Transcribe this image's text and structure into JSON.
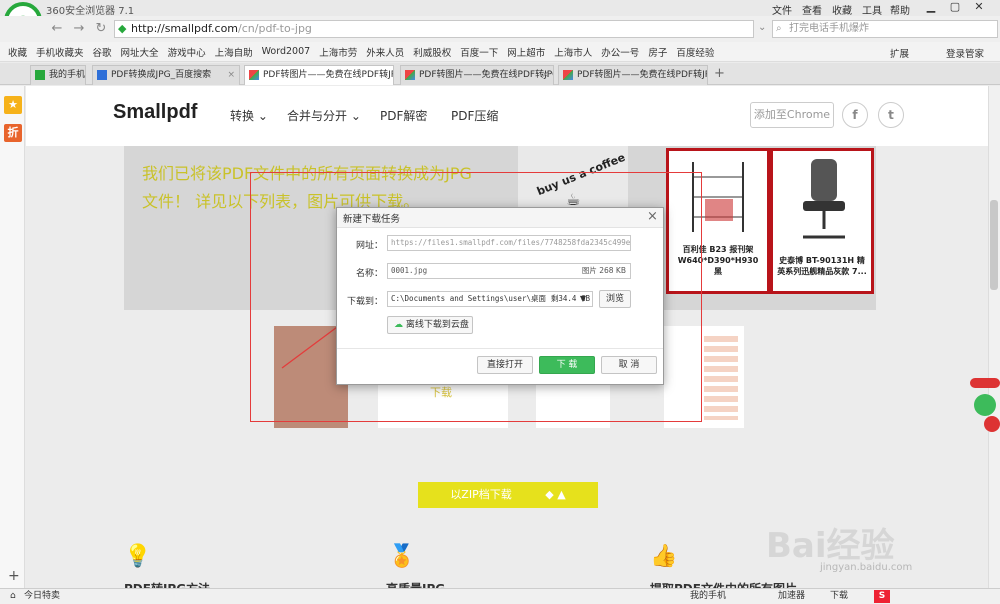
{
  "browser": {
    "app_title": "360安全浏览器 7.1",
    "menu": [
      "文件",
      "查看",
      "收藏",
      "工具",
      "帮助"
    ],
    "url_host": "http://smallpdf.com",
    "url_path": "/cn/pdf-to-jpg",
    "search_placeholder": "打完电话手机爆炸",
    "bookmarks": [
      "收藏",
      "手机收藏夹",
      "谷歌",
      "网址大全",
      "游戏中心",
      "上海自助",
      "Word2007",
      "上海市劳",
      "外来人员",
      "利威股权",
      "百度一下",
      "网上超市",
      "上海市人",
      "办公一号",
      "房子",
      "百度经验"
    ],
    "bookmarks_right": [
      "扩展",
      "登录管家"
    ],
    "tabs": [
      {
        "label": "我的手机"
      },
      {
        "label": "PDF转换成JPG_百度搜索"
      },
      {
        "label": "PDF转图片——免费在线PDF转JPG"
      },
      {
        "label": "PDF转图片——免费在线PDF转JPG"
      },
      {
        "label": "PDF转图片——免费在线PDF转JPG"
      }
    ],
    "sidebar_icon_2": "折",
    "status_left": "今日特卖",
    "status_items": [
      "我的手机",
      "加速器",
      "下载"
    ]
  },
  "site": {
    "logo": "Smallpdf",
    "nav": [
      "转换",
      "合并与分开",
      "PDF解密",
      "PDF压缩"
    ],
    "chrome_button": "添加至Chrome",
    "facebook": "f",
    "twitter": "t",
    "info_text": "我们已将该PDF文件中的所有页面转换成为JPG文件！ 详见以下列表，图片可供下载。",
    "coffee_text": "buy us a coffee",
    "ad1_label": "百利佳 B23 报刊架 W640*D390*H930 黑",
    "ad2_label": "史泰博 BT-90131H 精英系列迅舰精品灰款 7...",
    "thumb_download": "下载",
    "zip_button": "以ZIP档下载",
    "bottom_texts": [
      "PDF转JPG方法",
      "高质量JPG",
      "提取PDF文件中的所有图片"
    ]
  },
  "dialog": {
    "title": "新建下载任务",
    "url_label": "网址：",
    "url_value": "https://files1.smallpdf.com/files/7748258fda2345c499ef1091",
    "name_label": "名称：",
    "name_value": "0001.jpg",
    "name_type": "图片 268 KB",
    "save_label": "下载到：",
    "save_path": "C:\\Documents and Settings\\user\\桌面",
    "save_space": "剩34.4 GB",
    "browse": "浏览",
    "cloud": "离线下载到云盘",
    "open_btn": "直接打开",
    "download_btn": "下 载",
    "cancel_btn": "取 消"
  },
  "watermark": {
    "brand": "Bai经验",
    "url": "jingyan.baidu.com"
  },
  "colors": {
    "browser_green": "#27a83c",
    "download_green": "#3dbb5b",
    "zip_yellow": "#e6e11c",
    "ad_border": "#b8141a",
    "annotation_red": "#e43b3b"
  }
}
